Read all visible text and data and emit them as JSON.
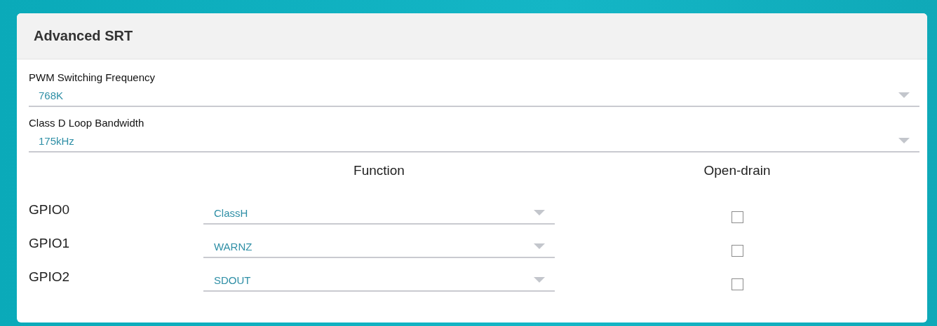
{
  "panel": {
    "title": "Advanced SRT"
  },
  "settings": [
    {
      "label": "PWM Switching Frequency",
      "value": "768K"
    },
    {
      "label": "Class D Loop Bandwidth",
      "value": "175kHz"
    }
  ],
  "gpio_table": {
    "columns": [
      "Function",
      "Open-drain"
    ],
    "rows": [
      {
        "name": "GPIO0",
        "function": "ClassH",
        "open_drain": false
      },
      {
        "name": "GPIO1",
        "function": "WARNZ",
        "open_drain": false
      },
      {
        "name": "GPIO2",
        "function": "SDOUT",
        "open_drain": false
      }
    ]
  }
}
